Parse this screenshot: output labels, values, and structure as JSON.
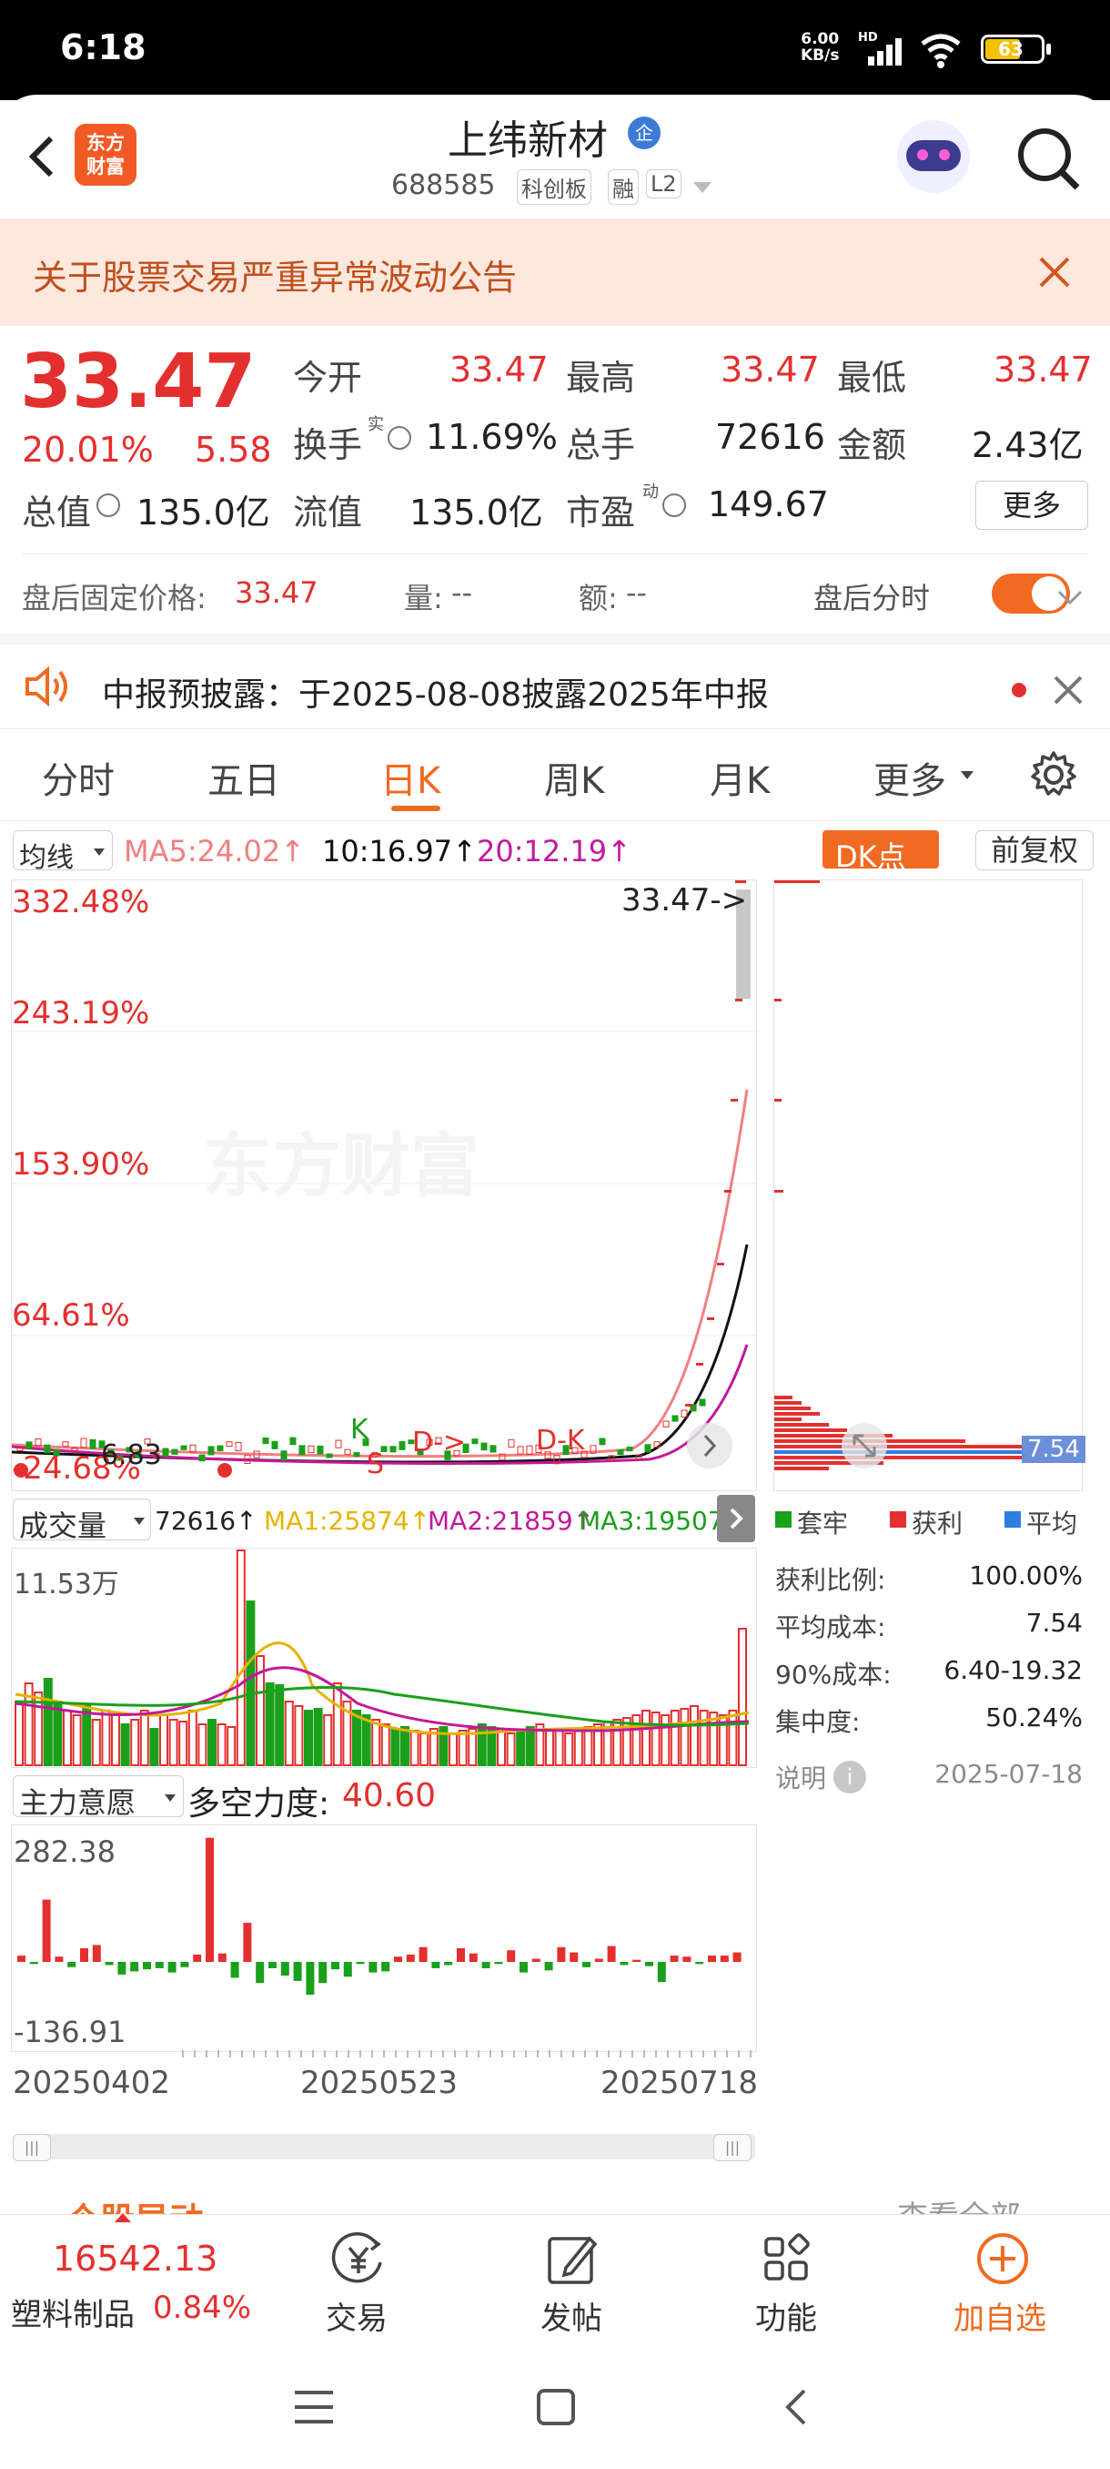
{
  "status": {
    "time": "6:18",
    "speed": "6.00\nKB/s",
    "speed_top": "6.00",
    "speed_bottom": "KB/s",
    "hd": "HD",
    "battery": "63"
  },
  "header": {
    "brand_line1": "东方",
    "brand_line2": "财富",
    "title": "上纬新材",
    "badge": "企",
    "code": "688585",
    "tag_board": "科创板",
    "tag_margin": "融",
    "tag_level": "L2"
  },
  "notice": {
    "text": "关于股票交易严重异常波动公告"
  },
  "quote": {
    "price": "33.47",
    "change_pct": "20.01%",
    "change_amt": "5.58",
    "open_label": "今开",
    "open": "33.47",
    "high_label": "最高",
    "high": "33.47",
    "low_label": "最低",
    "low": "33.47",
    "turnover_label": "换手",
    "turnover_sup": "实",
    "turnover": "11.69%",
    "volume_label": "总手",
    "volume": "72616",
    "amount_label": "金额",
    "amount": "2.43亿",
    "mktcap_label": "总值",
    "mktcap": "135.0亿",
    "float_label": "流值",
    "float": "135.0亿",
    "pe_label": "市盈",
    "pe_sup": "动",
    "pe": "149.67",
    "more_label": "更多"
  },
  "afterhours": {
    "price_label": "盘后固定价格:",
    "price": "33.47",
    "vol_label": "量:",
    "vol": "--",
    "amt_label": "额:",
    "amt": "--",
    "toggle_label": "盘后分时"
  },
  "disclosure": {
    "text": "中报预披露：于2025-08-08披露2025年中报"
  },
  "tabs": [
    {
      "label": "分时"
    },
    {
      "label": "五日"
    },
    {
      "label": "日K"
    },
    {
      "label": "周K"
    },
    {
      "label": "月K"
    },
    {
      "label": "更多"
    }
  ],
  "indicator": {
    "ma_select": "均线",
    "ma5": "MA5:24.02↑",
    "ma10": "10:16.97↑",
    "ma20": "20:12.19↑",
    "dk_label": "DK点",
    "adjust_label": "前复权"
  },
  "kline": {
    "price_labels": [
      "332.48%",
      "243.19%",
      "153.90%",
      "64.61%",
      "-24.68%"
    ],
    "last_price_marker": "33.47->",
    "low_marker": "6.83",
    "signals": [
      "K",
      "S",
      "D->",
      "D-K"
    ],
    "watermark": "东方财富"
  },
  "chip": {
    "current": "7.54",
    "legend": [
      {
        "label": "套牢",
        "color": "#1aa01a"
      },
      {
        "label": "获利",
        "color": "#e3302e"
      },
      {
        "label": "平均",
        "color": "#2f7de1"
      }
    ],
    "rows": [
      {
        "label": "获利比例:",
        "value": "100.00%"
      },
      {
        "label": "平均成本:",
        "value": "7.54"
      },
      {
        "label": "90%成本:",
        "value": "6.40-19.32"
      },
      {
        "label": "集中度:",
        "value": "50.24%"
      }
    ],
    "note_label": "说明",
    "date": "2025-07-18"
  },
  "volume_panel": {
    "select": "成交量",
    "vol": "72616↑",
    "ma1": "MA1:25874↑",
    "ma2": "MA2:21859↑",
    "ma3": "MA3:19507↑",
    "max_label": "11.53万"
  },
  "power_panel": {
    "select": "主力意愿",
    "label": "多空力度:",
    "value": "40.60",
    "max": "282.38",
    "min": "-136.91"
  },
  "dates": [
    "20250402",
    "20250523",
    "20250718"
  ],
  "section_hint": {
    "left": "个股异动",
    "right": "查看全部"
  },
  "footer": {
    "index_value": "16542.13",
    "index_name": "塑料制品",
    "index_pct": "0.84%",
    "trade": "交易",
    "post": "发帖",
    "func": "功能",
    "add": "加自选"
  },
  "colors": {
    "red": "#e3302e",
    "green": "#1aa01a",
    "orange": "#f06a22",
    "ma10_black": "#111111",
    "ma20_magenta": "#c2199b",
    "ma1_yellow": "#e5b300"
  }
}
